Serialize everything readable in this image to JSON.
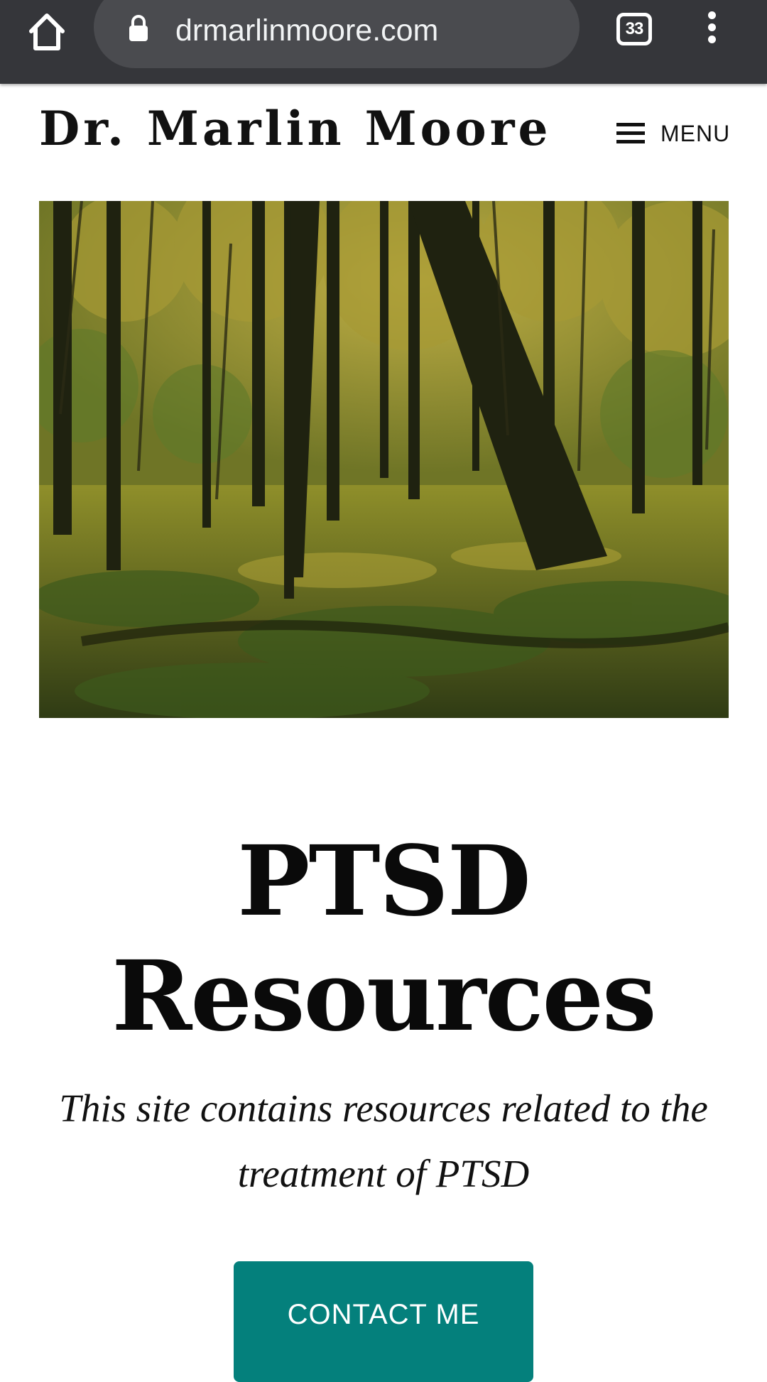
{
  "browser": {
    "url": "drmarlinmoore.com",
    "tab_count": "33",
    "icons": {
      "home": "home-icon",
      "lock": "lock-icon",
      "menu": "kebab-menu-icon"
    },
    "colors": {
      "toolbar": "#35363a",
      "omnibox": "#4a4b4f"
    }
  },
  "header": {
    "site_title": "Dr. Marlin Moore",
    "menu_label": "MENU"
  },
  "hero": {
    "alt": "forest-photo"
  },
  "main": {
    "title_line1": "PTSD",
    "title_line2": "Resources",
    "tagline": "This site contains resources related to the treatment of PTSD",
    "cta_label": "CONTACT ME"
  },
  "colors": {
    "accent": "#04807c",
    "text": "#111111"
  }
}
